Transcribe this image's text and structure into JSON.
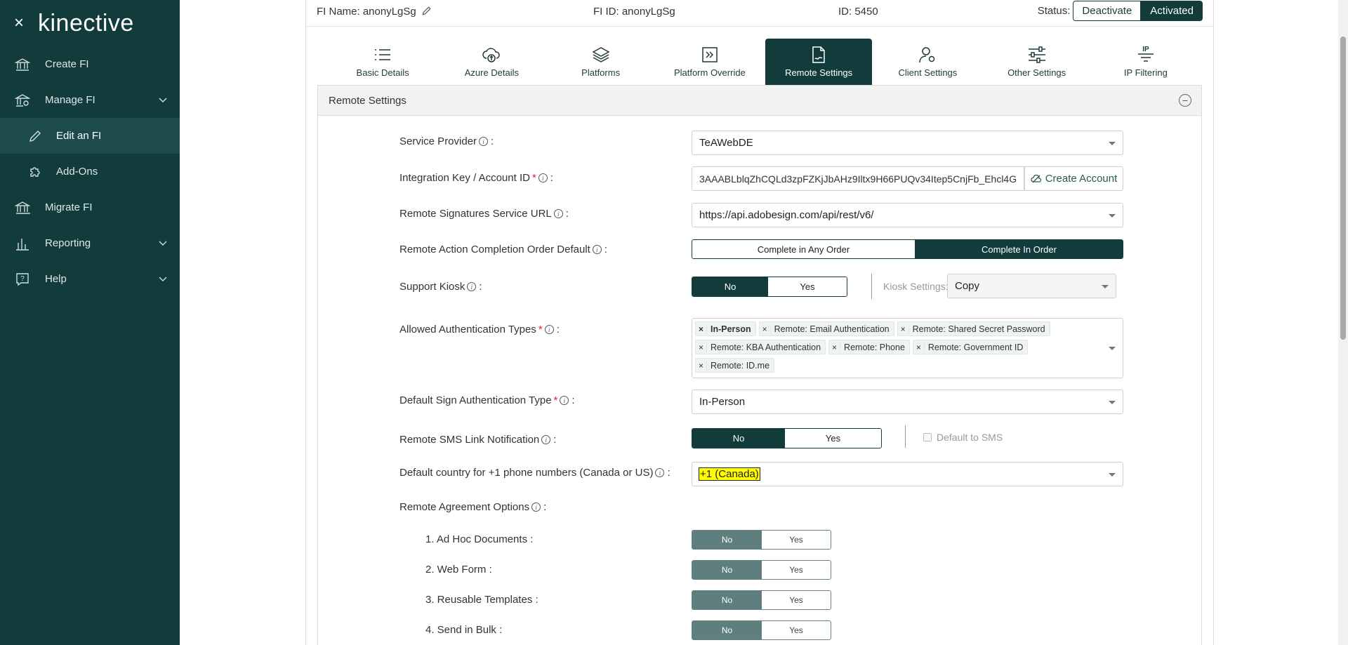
{
  "sidebar": {
    "close_icon": "×",
    "logo": "kinective",
    "items": [
      {
        "label": "Create FI"
      },
      {
        "label": "Manage FI"
      },
      {
        "label": "Edit an FI"
      },
      {
        "label": "Add-Ons"
      },
      {
        "label": "Migrate FI"
      },
      {
        "label": "Reporting"
      },
      {
        "label": "Help"
      }
    ]
  },
  "topbar": {
    "fi_name": "FI Name: anonyLgSg",
    "fi_id": "FI ID: anonyLgSg",
    "id": "ID: 5450",
    "status_label": "Status:",
    "deactivate": "Deactivate",
    "activated": "Activated"
  },
  "tabs": [
    {
      "label": "Basic Details",
      "icon": "list-icon"
    },
    {
      "label": "Azure Details",
      "icon": "cloud-upload-icon"
    },
    {
      "label": "Platforms",
      "icon": "layers-icon"
    },
    {
      "label": "Platform Override",
      "icon": "override-icon"
    },
    {
      "label": "Remote Settings",
      "icon": "remote-sign-icon"
    },
    {
      "label": "Client Settings",
      "icon": "user-gear-icon"
    },
    {
      "label": "Other Settings",
      "icon": "sliders-icon"
    },
    {
      "label": "IP Filtering",
      "icon": "ip-filter-icon",
      "badge": "IP"
    }
  ],
  "section": {
    "title": "Remote Settings",
    "collapse_symbol": "−"
  },
  "info_symbol": "i",
  "fields": {
    "service_provider": {
      "label": "Service Provider",
      "value": "TeAWebDE"
    },
    "integration_key": {
      "label": "Integration Key / Account ID",
      "value": "3AAABLblqZhCQLd3zpFZKjJbAHz9Iltx9H66PUQv34Itep5CnjFb_Ehcl4G",
      "button": "Create Account"
    },
    "remote_url": {
      "label": "Remote Signatures Service URL",
      "value": "https://api.adobesign.com/api/rest/v6/"
    },
    "completion_order": {
      "label": "Remote Action Completion Order Default",
      "options": [
        "Complete in Any Order",
        "Complete In Order"
      ],
      "selected": "Complete In Order"
    },
    "support_kiosk": {
      "label": "Support Kiosk",
      "options": [
        "No",
        "Yes"
      ],
      "selected": "No",
      "kiosk_settings_label": "Kiosk Settings:",
      "kiosk_settings_value": "Copy"
    },
    "auth_types": {
      "label": "Allowed Authentication Types",
      "tags": [
        "In-Person",
        "Remote: Email Authentication",
        "Remote: Shared Secret Password",
        "Remote: KBA Authentication",
        "Remote: Phone",
        "Remote: Government ID",
        "Remote: ID.me"
      ]
    },
    "default_sign_auth": {
      "label": "Default Sign Authentication Type",
      "value": "In-Person"
    },
    "sms_link": {
      "label": "Remote SMS Link Notification",
      "options": [
        "No",
        "Yes"
      ],
      "selected": "No",
      "default_to_sms": "Default to SMS"
    },
    "default_country": {
      "label": "Default country for +1 phone numbers (Canada or US)",
      "value": "+1 (Canada)"
    },
    "agreement_options": {
      "label": "Remote Agreement Options"
    },
    "ad_hoc": {
      "label": "1. Ad Hoc Documents :",
      "options": [
        "No",
        "Yes"
      ]
    },
    "web_form": {
      "label": "2. Web Form :",
      "options": [
        "No",
        "Yes"
      ]
    },
    "reusable_templates": {
      "label": "3. Reusable Templates :",
      "options": [
        "No",
        "Yes"
      ]
    },
    "send_bulk": {
      "label": "4. Send in Bulk :",
      "options": [
        "No",
        "Yes"
      ]
    }
  },
  "colon": ":",
  "required_mark": "*"
}
